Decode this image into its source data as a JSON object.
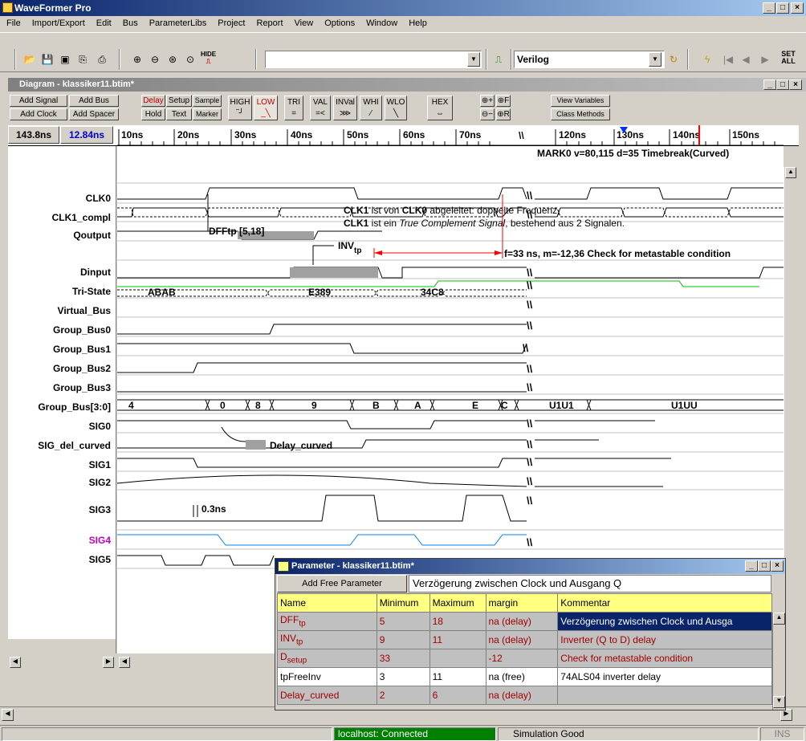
{
  "app": {
    "title": "WaveFormer Pro"
  },
  "menu": [
    "File",
    "Import/Export",
    "Edit",
    "Bus",
    "ParameterLibs",
    "Project",
    "Report",
    "View",
    "Options",
    "Window",
    "Help"
  ],
  "toolbar": {
    "hide_label": "HIDE",
    "language": "Verilog",
    "set_all": "SET ALL"
  },
  "diagram": {
    "title": "Diagram - klassiker11.btim*"
  },
  "buttons": {
    "add_signal": "Add Signal",
    "add_bus": "Add Bus",
    "add_clock": "Add Clock",
    "add_spacer": "Add Spacer",
    "delay": "Delay",
    "setup": "Setup",
    "sample": "Sample",
    "hold": "Hold",
    "text": "Text",
    "marker": "Marker",
    "high": "HIGH",
    "low": "LOW",
    "tri": "TRI",
    "val": "VAL",
    "inval": "INVal",
    "whi": "WHI",
    "wlo": "WLO",
    "hex": "HEX",
    "view_variables": "View Variables",
    "class_methods": "Class Methods"
  },
  "times": {
    "cursor": "143.8ns",
    "delta": "12.84ns"
  },
  "ruler": [
    "10ns",
    "20ns",
    "30ns",
    "40ns",
    "50ns",
    "60ns",
    "70ns",
    "120ns",
    "130ns",
    "140ns",
    "150ns"
  ],
  "signals": [
    "CLK0",
    "CLK1_compl",
    "Qoutput",
    "Dinput",
    "Tri-State",
    "Virtual_Bus",
    "Group_Bus0",
    "Group_Bus1",
    "Group_Bus2",
    "Group_Bus3",
    "Group_Bus[3:0]",
    "SIG0",
    "SIG_del_curved",
    "SIG1",
    "SIG2",
    "SIG3",
    "SIG4",
    "SIG5"
  ],
  "annotations": {
    "marker": "MARK0 v=80,115 d=35 Timebreak(Curved)",
    "dff": "DFFtp [5,18]",
    "clk1_line1_a": "CLK1",
    "clk1_line1_b": " ist von ",
    "clk1_line1_c": "CLK0",
    "clk1_line1_d": " abgeleitet: doppelte Frequenz,",
    "clk1_line2_a": "CLK1",
    "clk1_line2_b": " ist ein ",
    "clk1_line2_c": "True Complement Signal",
    "clk1_line2_d": ", bestehend aus 2 Signalen.",
    "inv": "INV",
    "inv_sub": "tp",
    "setup": "f=33 ns, m=-12,36 Check for metastable condition",
    "delay_curved": "Delay_curved",
    "sig3_delay": "0.3ns"
  },
  "bus_values": {
    "virtual": [
      "ABAB",
      "E389",
      "34C8"
    ],
    "group": [
      "4",
      "0",
      "8",
      "9",
      "B",
      "A",
      "E",
      "C",
      "U1U1",
      "U1UU"
    ]
  },
  "param_window": {
    "title": "Parameter - klassiker11.btim*",
    "add_button": "Add Free Parameter",
    "edit_value": "Verzögerung zwischen Clock und Ausgang Q",
    "columns": [
      "Name",
      "Minimum",
      "Maximum",
      "margin",
      "Kommentar"
    ],
    "rows": [
      {
        "name": "DFF",
        "sub": "tp",
        "min": "5",
        "max": "18",
        "margin": "na (delay)",
        "comment": "Verzögerung zwischen Clock und Ausga"
      },
      {
        "name": "INV",
        "sub": "tp",
        "min": "9",
        "max": "11",
        "margin": "na (delay)",
        "comment": "Inverter (Q to D) delay"
      },
      {
        "name": "D",
        "sub": "setup",
        "min": "33",
        "max": "",
        "margin": "-12",
        "comment": "Check for metastable condition"
      },
      {
        "name": "tpFreeInv",
        "sub": "",
        "min": "3",
        "max": "11",
        "margin": "na (free)",
        "comment": "74ALS04 inverter delay"
      },
      {
        "name": "Delay_curved",
        "sub": "",
        "min": "2",
        "max": "6",
        "margin": "na (delay)",
        "comment": ""
      }
    ]
  },
  "status": {
    "connection": "localhost: Connected",
    "simulation": "Simulation Good",
    "mode": "INS"
  },
  "colors": {
    "title": "#0a246a",
    "selected_row": "#0a246a",
    "param_header": "#ffff80",
    "status_green": "#008000",
    "sig4": "#c000c0",
    "tri_state": "#00c000",
    "blue_wave": "#0080ff"
  }
}
